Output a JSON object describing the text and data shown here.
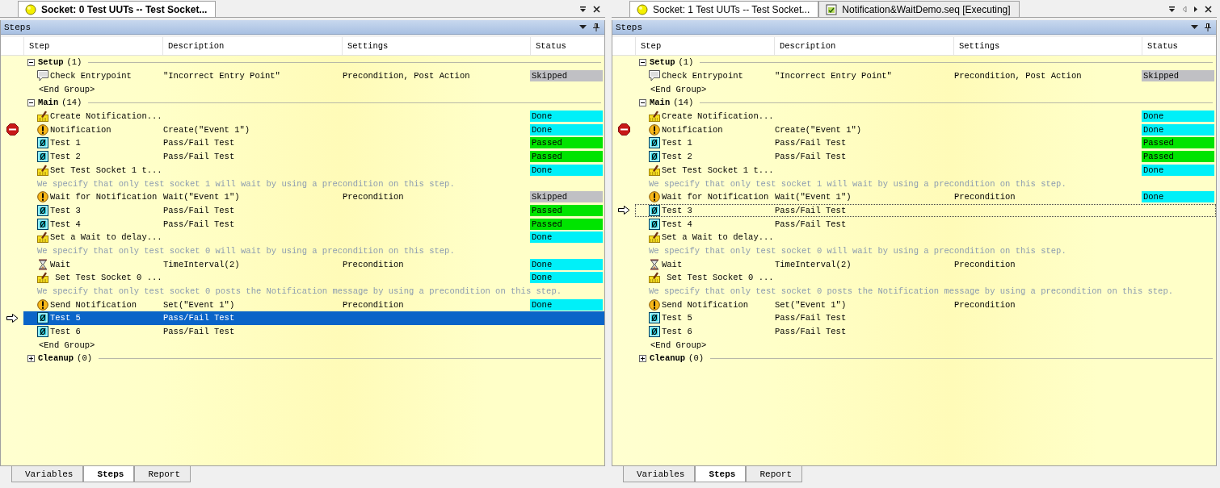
{
  "panes": [
    {
      "active": true,
      "doc_tabs": [
        {
          "title": "Socket: 0  Test UUTs -- Test Socket...",
          "kind": "socket",
          "selected": true
        }
      ],
      "panel_title": "Steps",
      "columns": [
        "Step",
        "Description",
        "Settings",
        "Status"
      ],
      "rows": [
        {
          "kind": "group",
          "name": "Setup",
          "count": "(1)",
          "expanded": true
        },
        {
          "kind": "message",
          "name": "Check Entrypoint",
          "description": "\"Incorrect Entry Point\"",
          "settings": "Precondition, Post Action",
          "status": "Skipped",
          "color": "#c0c0c4",
          "selected": false,
          "breakpoint": false,
          "pointer": false
        },
        {
          "kind": "end",
          "text": "<End Group>"
        },
        {
          "kind": "group",
          "name": "Main",
          "count": "(14)",
          "expanded": true
        },
        {
          "kind": "statement",
          "name": "Create Notification...",
          "status": "Done",
          "color": "#00f0f8",
          "selected": false,
          "breakpoint": false,
          "pointer": false
        },
        {
          "kind": "alert",
          "name": "Notification",
          "description": "Create(\"Event 1\")",
          "status": "Done",
          "color": "#00f0f8",
          "selected": false,
          "breakpoint": true,
          "pointer": false
        },
        {
          "kind": "test",
          "name": "Test 1",
          "description": "Pass/Fail Test",
          "status": "Passed",
          "color": "#00e400",
          "selected": false,
          "breakpoint": false,
          "pointer": false
        },
        {
          "kind": "test",
          "name": "Test 2",
          "description": "Pass/Fail Test",
          "status": "Passed",
          "color": "#00e400",
          "selected": false,
          "breakpoint": false,
          "pointer": false
        },
        {
          "kind": "statement",
          "name": "Set Test Socket 1 t...",
          "status": "Done",
          "color": "#00f0f8",
          "selected": false,
          "breakpoint": false,
          "pointer": false
        },
        {
          "kind": "comment",
          "text": "We specify that only test socket 1 will wait by using a precondition on this step."
        },
        {
          "kind": "alert",
          "name": "Wait for Notification",
          "description": "Wait(\"Event 1\")",
          "settings": "Precondition",
          "status": "Skipped",
          "color": "#c0c0c4",
          "selected": false,
          "breakpoint": false,
          "pointer": false
        },
        {
          "kind": "test",
          "name": "Test 3",
          "description": "Pass/Fail Test",
          "status": "Passed",
          "color": "#00e400",
          "selected": false,
          "breakpoint": false,
          "pointer": false
        },
        {
          "kind": "test",
          "name": "Test 4",
          "description": "Pass/Fail Test",
          "status": "Passed",
          "color": "#00e400",
          "selected": false,
          "breakpoint": false,
          "pointer": false
        },
        {
          "kind": "statement",
          "name": "Set a Wait to delay...",
          "status": "Done",
          "color": "#00f0f8",
          "selected": false,
          "breakpoint": false,
          "pointer": false
        },
        {
          "kind": "comment",
          "text": "We specify that only test socket 0 will wait by using a precondition on this step."
        },
        {
          "kind": "wait",
          "name": "Wait",
          "description": "TimeInterval(2)",
          "settings": "Precondition",
          "status": "Done",
          "color": "#00f0f8",
          "selected": false,
          "breakpoint": false,
          "pointer": false
        },
        {
          "kind": "statement",
          "name": " Set Test Socket 0 ...",
          "status": "Done",
          "color": "#00f0f8",
          "selected": false,
          "breakpoint": false,
          "pointer": false
        },
        {
          "kind": "comment",
          "text": "We specify that only test socket 0 posts the Notification message by using a precondition on this step."
        },
        {
          "kind": "alert",
          "name": "Send Notification",
          "description": "Set(\"Event 1\")",
          "settings": "Precondition",
          "status": "Done",
          "color": "#00f0f8",
          "selected": false,
          "breakpoint": false,
          "pointer": false
        },
        {
          "kind": "test",
          "name": "Test 5",
          "description": "Pass/Fail Test",
          "selected": true,
          "breakpoint": false,
          "pointer": true
        },
        {
          "kind": "test",
          "name": "Test 6",
          "description": "Pass/Fail Test",
          "selected": false,
          "breakpoint": false,
          "pointer": false
        },
        {
          "kind": "end",
          "text": "<End Group>"
        },
        {
          "kind": "group",
          "name": "Cleanup",
          "count": "(0)",
          "expanded": false
        }
      ],
      "bottom_tabs": [
        {
          "label": "Variables",
          "selected": false
        },
        {
          "label": "Steps",
          "selected": true
        },
        {
          "label": "Report",
          "selected": false
        }
      ]
    },
    {
      "active": false,
      "doc_tabs": [
        {
          "title": "Socket: 1  Test UUTs -- Test Socket...",
          "kind": "socket",
          "selected": true
        },
        {
          "title": "Notification&WaitDemo.seq [Executing]",
          "kind": "sequence",
          "selected": false
        }
      ],
      "panel_title": "Steps",
      "columns": [
        "Step",
        "Description",
        "Settings",
        "Status"
      ],
      "rows": [
        {
          "kind": "group",
          "name": "Setup",
          "count": "(1)",
          "expanded": true
        },
        {
          "kind": "message",
          "name": "Check Entrypoint",
          "description": "\"Incorrect Entry Point\"",
          "settings": "Precondition, Post Action",
          "status": "Skipped",
          "color": "#c0c0c4",
          "selected": false,
          "breakpoint": false,
          "pointer": false
        },
        {
          "kind": "end",
          "text": "<End Group>"
        },
        {
          "kind": "group",
          "name": "Main",
          "count": "(14)",
          "expanded": true
        },
        {
          "kind": "statement",
          "name": "Create Notification...",
          "status": "Done",
          "color": "#00f0f8",
          "selected": false,
          "breakpoint": false,
          "pointer": false
        },
        {
          "kind": "alert",
          "name": "Notification",
          "description": "Create(\"Event 1\")",
          "status": "Done",
          "color": "#00f0f8",
          "selected": false,
          "breakpoint": true,
          "pointer": false
        },
        {
          "kind": "test",
          "name": "Test 1",
          "description": "Pass/Fail Test",
          "status": "Passed",
          "color": "#00e400",
          "selected": false,
          "breakpoint": false,
          "pointer": false
        },
        {
          "kind": "test",
          "name": "Test 2",
          "description": "Pass/Fail Test",
          "status": "Passed",
          "color": "#00e400",
          "selected": false,
          "breakpoint": false,
          "pointer": false
        },
        {
          "kind": "statement",
          "name": "Set Test Socket 1 t...",
          "status": "Done",
          "color": "#00f0f8",
          "selected": false,
          "breakpoint": false,
          "pointer": false
        },
        {
          "kind": "comment",
          "text": "We specify that only test socket 1 will wait by using a precondition on this step."
        },
        {
          "kind": "alert",
          "name": "Wait for Notification",
          "description": "Wait(\"Event 1\")",
          "settings": "Precondition",
          "status": "Done",
          "color": "#00f0f8",
          "selected": false,
          "breakpoint": false,
          "pointer": false
        },
        {
          "kind": "test",
          "name": "Test 3",
          "description": "Pass/Fail Test",
          "selected": true,
          "breakpoint": false,
          "pointer": true
        },
        {
          "kind": "test",
          "name": "Test 4",
          "description": "Pass/Fail Test",
          "selected": false,
          "breakpoint": false,
          "pointer": false
        },
        {
          "kind": "statement",
          "name": "Set a Wait to delay...",
          "selected": false,
          "breakpoint": false,
          "pointer": false
        },
        {
          "kind": "comment",
          "text": "We specify that only test socket 0 will wait by using a precondition on this step."
        },
        {
          "kind": "wait",
          "name": "Wait",
          "description": "TimeInterval(2)",
          "settings": "Precondition",
          "selected": false,
          "breakpoint": false,
          "pointer": false
        },
        {
          "kind": "statement",
          "name": " Set Test Socket 0 ...",
          "selected": false,
          "breakpoint": false,
          "pointer": false
        },
        {
          "kind": "comment",
          "text": "We specify that only test socket 0 posts the Notification message by using a precondition on this step."
        },
        {
          "kind": "alert",
          "name": "Send Notification",
          "description": "Set(\"Event 1\")",
          "settings": "Precondition",
          "selected": false,
          "breakpoint": false,
          "pointer": false
        },
        {
          "kind": "test",
          "name": "Test 5",
          "description": "Pass/Fail Test",
          "selected": false,
          "breakpoint": false,
          "pointer": false
        },
        {
          "kind": "test",
          "name": "Test 6",
          "description": "Pass/Fail Test",
          "selected": false,
          "breakpoint": false,
          "pointer": false
        },
        {
          "kind": "end",
          "text": "<End Group>"
        },
        {
          "kind": "group",
          "name": "Cleanup",
          "count": "(0)",
          "expanded": false
        }
      ],
      "bottom_tabs": [
        {
          "label": "Variables",
          "selected": false
        },
        {
          "label": "Steps",
          "selected": true
        },
        {
          "label": "Report",
          "selected": false
        }
      ]
    }
  ]
}
